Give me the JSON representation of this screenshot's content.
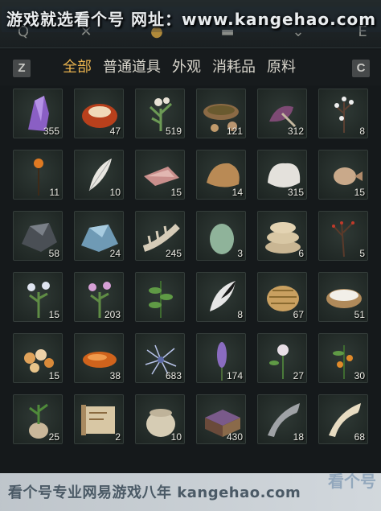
{
  "watermark": {
    "top": "游戏就选看个号   网址：www.kangehao.com",
    "bottom": "看个号专业网易游戏八年 kangehao.com",
    "logo": "看个号"
  },
  "top_icons": [
    {
      "name": "q-key-icon",
      "glyph": "Q"
    },
    {
      "name": "close-x-icon",
      "glyph": "✕"
    },
    {
      "name": "pouch-icon",
      "glyph": "●"
    },
    {
      "name": "book-icon",
      "glyph": "▬"
    },
    {
      "name": "chevron-down-icon",
      "glyph": "⌄"
    },
    {
      "name": "e-key-icon",
      "glyph": "E"
    }
  ],
  "tabs": {
    "prev_key": "Z",
    "next_key": "C",
    "items": [
      "全部",
      "普通道具",
      "外观",
      "消耗品",
      "原料"
    ],
    "active_index": 0,
    "active_color": "#e8b24e"
  },
  "items": [
    {
      "icon": "purple-crystal-icon",
      "count": "355"
    },
    {
      "icon": "red-amber-stone-icon",
      "count": "47"
    },
    {
      "icon": "white-herb-icon",
      "count": "519"
    },
    {
      "icon": "herb-bowl-icon",
      "count": "121"
    },
    {
      "icon": "purple-flower-icon",
      "count": "312"
    },
    {
      "icon": "white-blossom-icon",
      "count": "8"
    },
    {
      "icon": "orange-flower-icon",
      "count": "11"
    },
    {
      "icon": "white-feather-icon",
      "count": "10"
    },
    {
      "icon": "raw-meat-icon",
      "count": "15"
    },
    {
      "icon": "fungus-icon",
      "count": "14"
    },
    {
      "icon": "white-fur-icon",
      "count": "315"
    },
    {
      "icon": "pufferfish-icon",
      "count": "15"
    },
    {
      "icon": "dark-ore-icon",
      "count": "58"
    },
    {
      "icon": "blue-ore-icon",
      "count": "24"
    },
    {
      "icon": "bone-spine-icon",
      "count": "245"
    },
    {
      "icon": "green-egg-icon",
      "count": "3"
    },
    {
      "icon": "cloth-bundle-icon",
      "count": "6"
    },
    {
      "icon": "red-berry-branch-icon",
      "count": "5"
    },
    {
      "icon": "white-wildflower-icon",
      "count": "15"
    },
    {
      "icon": "pink-wildflower-icon",
      "count": "203"
    },
    {
      "icon": "green-leaf-plant-icon",
      "count": ""
    },
    {
      "icon": "black-white-feather-icon",
      "count": "8"
    },
    {
      "icon": "woven-basket-icon",
      "count": "67"
    },
    {
      "icon": "milk-bowl-icon",
      "count": "51"
    },
    {
      "icon": "amber-nuggets-icon",
      "count": "15"
    },
    {
      "icon": "orange-stone-icon",
      "count": "38"
    },
    {
      "icon": "blue-spiky-flower-icon",
      "count": "683"
    },
    {
      "icon": "lavender-spike-icon",
      "count": "174"
    },
    {
      "icon": "white-daisy-icon",
      "count": "27"
    },
    {
      "icon": "orange-fruit-plant-icon",
      "count": "30"
    },
    {
      "icon": "potted-plant-icon",
      "count": "25"
    },
    {
      "icon": "scroll-map-icon",
      "count": "2"
    },
    {
      "icon": "ceramic-jar-icon",
      "count": "10"
    },
    {
      "icon": "purple-chest-icon",
      "count": "430"
    },
    {
      "icon": "horn-icon",
      "count": "18"
    },
    {
      "icon": "ivory-horn-icon",
      "count": "68"
    }
  ],
  "colors": {
    "count_text": "#ecebe4",
    "tab_text": "#d9d6cc"
  }
}
